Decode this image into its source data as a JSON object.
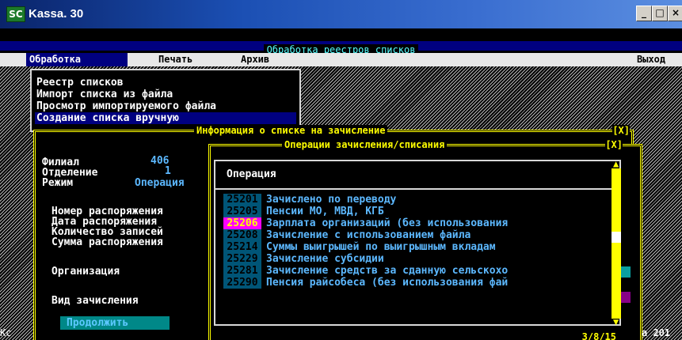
{
  "window": {
    "title": "Kassa. 30",
    "logo": "SC",
    "btn_min": "_",
    "btn_max": "□",
    "btn_close": "×"
  },
  "screen": {
    "title": "Обработка реестров списков"
  },
  "menu": {
    "items": [
      "Обработка",
      "Печать",
      "Архив"
    ],
    "exit": "Выход"
  },
  "dropdown": {
    "items": [
      "Реестр списков",
      "Импорт списка из файла",
      "Просмотр импортируемого файла",
      "Создание списка вручную"
    ],
    "selected_index": 3
  },
  "info_dialog": {
    "title": "Информация о списке на зачисление",
    "close": "[X]",
    "fields": {
      "branch_label": "Филиал",
      "branch_value": "406",
      "department_label": "Отделение",
      "department_value": "1",
      "mode_label": "Режим",
      "mode_value": "Операция",
      "order_number_label": "Номер распоряжения",
      "order_date_label": "Дата распоряжения",
      "records_count_label": "Количество записей",
      "order_sum_label": "Сумма распоряжения",
      "organization_label": "Организация",
      "credit_type_label": "Вид зачисления"
    },
    "continue_button": "Продолжить"
  },
  "ops_dialog": {
    "title": "Операции зачисления/списания",
    "close": "[X]",
    "column_header": "Операция",
    "selected_index": 2,
    "rows": [
      {
        "code": "25201",
        "text": "Зачислено по переводу"
      },
      {
        "code": "25205",
        "text": "Пенсии МО, МВД, КГБ"
      },
      {
        "code": "25206",
        "text": "Зарплата организаций (без использования"
      },
      {
        "code": "25208",
        "text": "Зачисление с использованием файла"
      },
      {
        "code": "25214",
        "text": "Суммы выигрышей по выигрышным вкладам"
      },
      {
        "code": "25229",
        "text": "Зачисление субсидии"
      },
      {
        "code": "25281",
        "text": "Зачисление средств за сданную сельскохо"
      },
      {
        "code": "25290",
        "text": "Пенсия райсобеса (без использования фай"
      }
    ],
    "counter": "3/8/15"
  },
  "corner": {
    "left": "Kc",
    "right": "a 201"
  },
  "colors": {
    "yellow": "#ffff00",
    "navy": "#000080",
    "cyan_text": "#5cb8ff",
    "teal_code": "#005577",
    "magenta_sel": "#ff00ff"
  }
}
